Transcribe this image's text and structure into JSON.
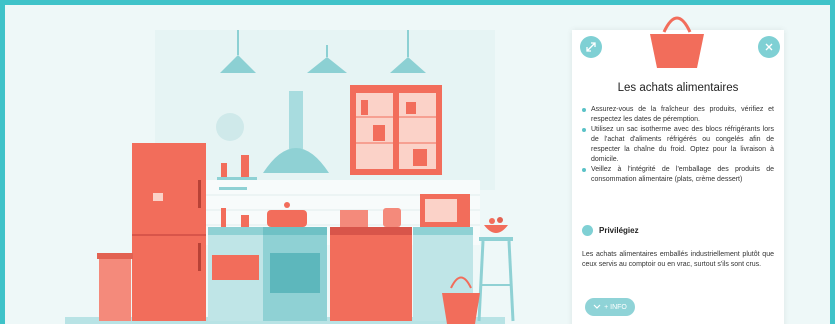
{
  "colors": {
    "accent": "#7fd0d4",
    "brand_coral": "#f26d5b",
    "frame": "#3fc3c9"
  },
  "panel": {
    "expand_icon": "expand-arrows-icon",
    "close_icon": "close-icon",
    "title": "Les achats alimentaires",
    "bullets": [
      "Assurez-vous de la fraîcheur des produits, vérifiez et respectez les dates de péremption.",
      "Utilisez un sac isotherme avec des blocs réfrigérants lors de l'achat d'aliments réfrigérés ou congelés afin de respecter la chaîne du froid. Optez pour la livraison à domicile.",
      "Veillez à l'intégrité de l'emballage des produits de consommation alimentaire (plats, crème dessert)"
    ],
    "section_title": "Privilégiez",
    "section_text": "Les achats alimentaires emballés industriellement plutôt que ceux servis au comptoir ou en vrac, surtout s'ils sont crus.",
    "info_button": "+ INFO",
    "info_icon": "chevron-down-icon"
  }
}
